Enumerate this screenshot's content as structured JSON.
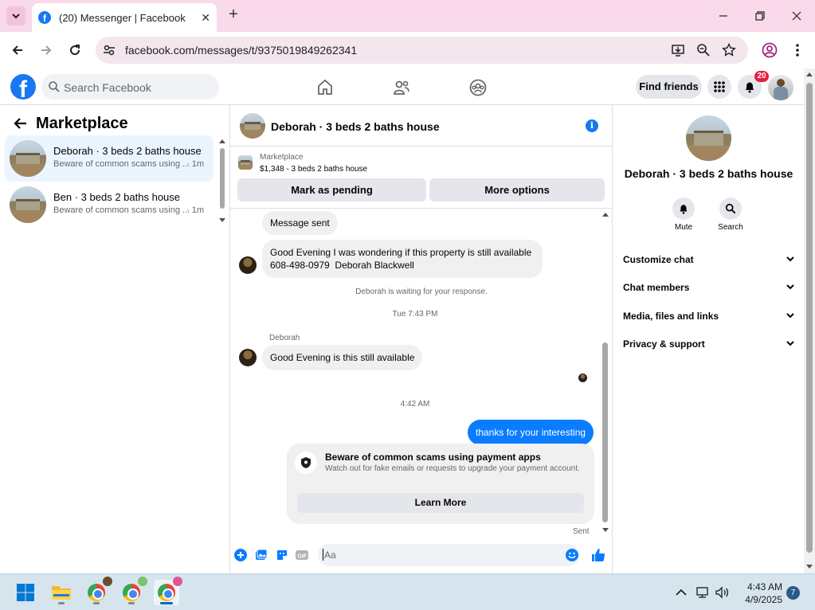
{
  "browser": {
    "tab_title": "(20) Messenger | Facebook",
    "url": "facebook.com/messages/t/9375019849262341"
  },
  "fb_header": {
    "search_placeholder": "Search Facebook",
    "find_friends_label": "Find friends",
    "notification_count": "20"
  },
  "left": {
    "title": "Marketplace",
    "conversations": [
      {
        "name": "Deborah · 3 beds 2 baths house",
        "preview": "Beware of common scams using ...",
        "time": "· 1m",
        "active": true
      },
      {
        "name": "Ben · 3 beds 2 baths house",
        "preview": "Beware of common scams using ...",
        "time": "· 1m",
        "active": false
      }
    ]
  },
  "chat": {
    "title": "Deborah · 3 beds 2 baths house",
    "listing": {
      "source": "Marketplace",
      "description": "$1,348 - 3 beds 2 baths house",
      "mark_pending_label": "Mark as pending",
      "more_options_label": "More options"
    },
    "messages": {
      "message_sent": "Message sent",
      "inquiry_line1": "Good Evening I was wondering if this property is still available",
      "inquiry_line2": "608-498-0979  Deborah Blackwell",
      "waiting_notice": "Deborah is waiting for your response.",
      "timestamp_1": "Tue 7:43 PM",
      "sender_name": "Deborah",
      "reply": "Good Evening is this still available",
      "timestamp_2": "4:42 AM",
      "outgoing": "thanks for your interesting",
      "scam_title": "Beware of common scams using payment apps",
      "scam_body": "Watch out for fake emails or requests to upgrade your payment account.",
      "learn_more_label": "Learn More",
      "sent_label": "Sent"
    },
    "composer_placeholder": "Aa"
  },
  "right": {
    "title": "Deborah · 3 beds 2 baths house",
    "actions": [
      {
        "label": "Mute",
        "icon": "bell-icon"
      },
      {
        "label": "Search",
        "icon": "search-icon"
      }
    ],
    "sections": [
      "Customize chat",
      "Chat members",
      "Media, files and links",
      "Privacy & support"
    ]
  },
  "taskbar": {
    "time": "4:43 AM",
    "date": "4/9/2025",
    "notification_count": "7"
  },
  "colors": {
    "facebook_blue": "#1877f2",
    "messenger_blue": "#0a7cff",
    "tab_bar": "#f9d9ea",
    "taskbar": "#d6e4ee"
  }
}
